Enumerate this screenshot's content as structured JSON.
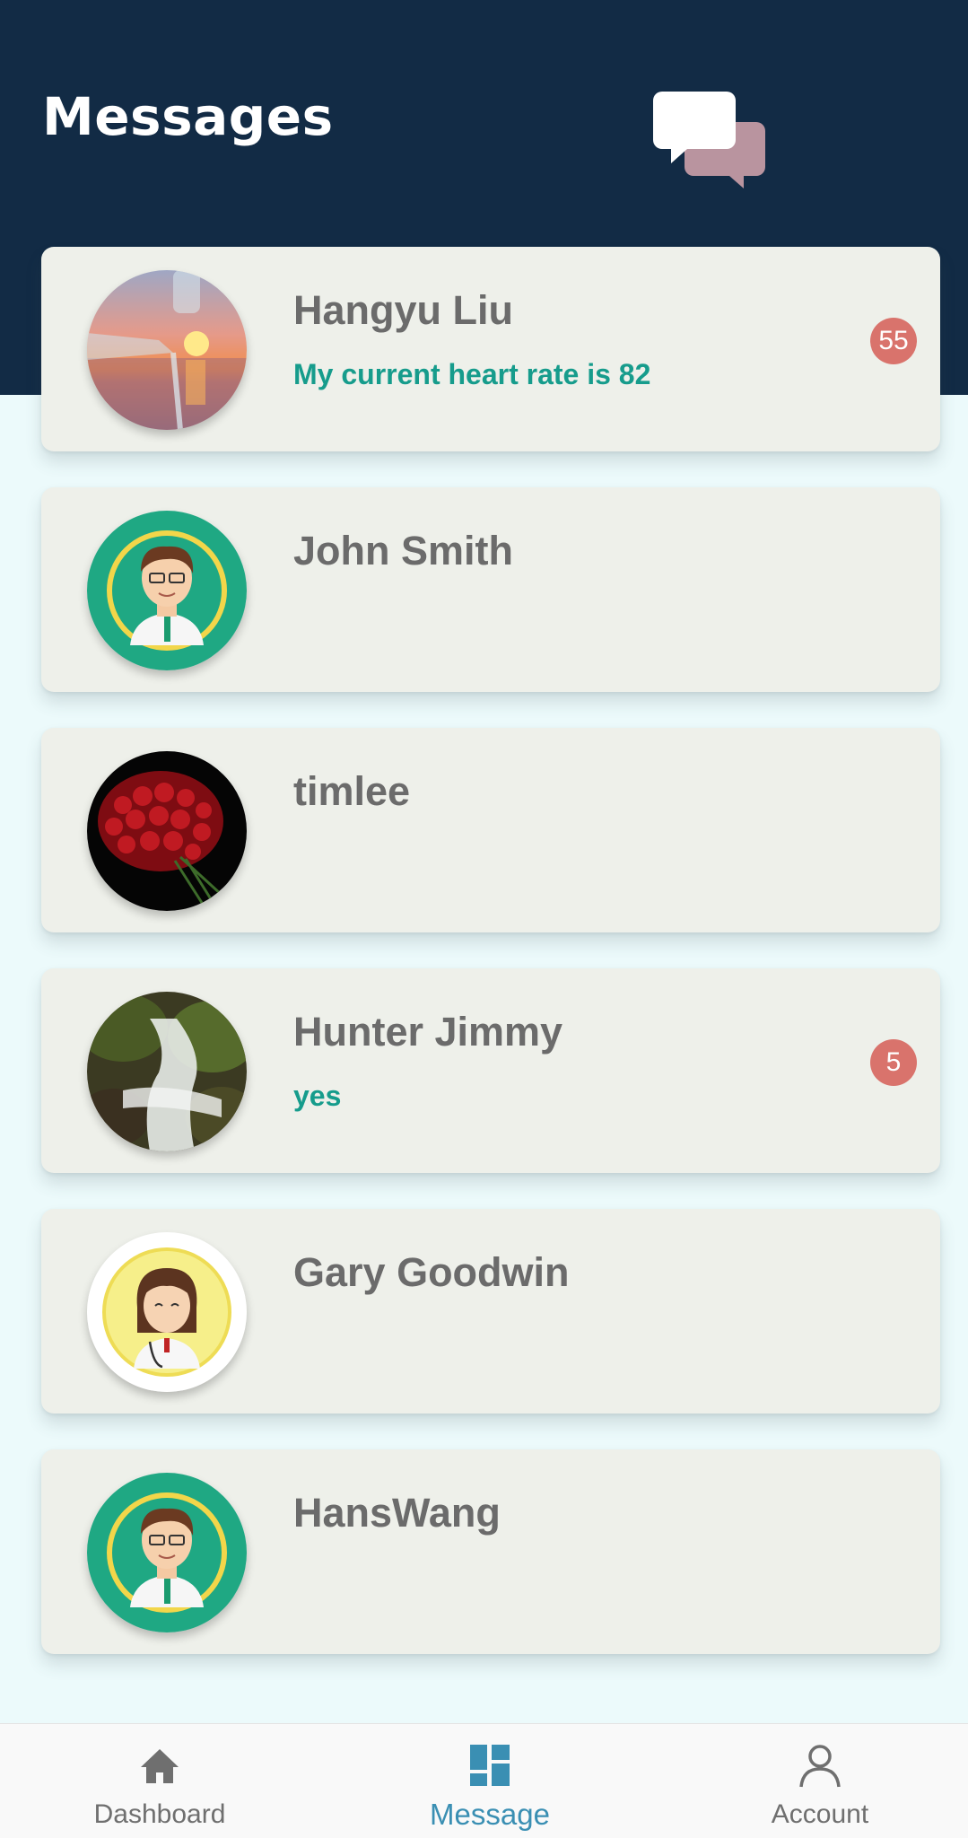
{
  "header": {
    "title": "Messages",
    "icon": "chat-bubbles-icon",
    "background_color": "#122b45"
  },
  "conversations": [
    {
      "name": "Hangyu Liu",
      "last_message": "My current heart rate is 82",
      "unread_count": "55",
      "avatar": "sunset-photo"
    },
    {
      "name": "John Smith",
      "last_message": "",
      "unread_count": "",
      "avatar": "doctor-male-illustration"
    },
    {
      "name": "timlee",
      "last_message": "",
      "unread_count": "",
      "avatar": "red-roses-photo"
    },
    {
      "name": "Hunter Jimmy",
      "last_message": "yes",
      "unread_count": "5",
      "avatar": "waterfall-photo"
    },
    {
      "name": "Gary Goodwin",
      "last_message": "",
      "unread_count": "",
      "avatar": "doctor-female-illustration"
    },
    {
      "name": "HansWang",
      "last_message": "",
      "unread_count": "",
      "avatar": "doctor-male-illustration"
    }
  ],
  "bottom_nav": {
    "items": [
      {
        "label": "Dashboard",
        "icon": "home-icon",
        "active": false
      },
      {
        "label": "Message",
        "icon": "grid-icon",
        "active": true
      },
      {
        "label": "Account",
        "icon": "person-icon",
        "active": false
      }
    ]
  },
  "colors": {
    "accent_message": "#169c8c",
    "badge": "#d9736c",
    "nav_active": "#3a8fb3"
  }
}
